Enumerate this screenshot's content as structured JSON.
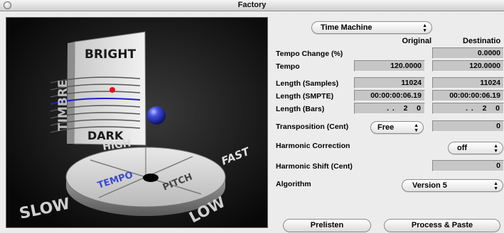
{
  "window": {
    "title": "Factory"
  },
  "visual": {
    "labels": {
      "bright": "BRIGHT",
      "timbre": "TIMBRE",
      "dark": "DARK",
      "high": "HIGH",
      "fast": "FAST",
      "slow": "SLOW",
      "low": "LOW",
      "tempo": "TEMPO",
      "pitch": "PITCH"
    }
  },
  "controls": {
    "mode_popup": "Time Machine",
    "columns": {
      "original": "Original",
      "destination": "Destinatio"
    },
    "rows": [
      {
        "label": "Tempo Change (%)",
        "original": "",
        "destination": "0.0000"
      },
      {
        "label": "Tempo",
        "original": "120.0000",
        "destination": "120.0000"
      },
      {
        "label": "Length (Samples)",
        "original": "11024",
        "destination": "11024"
      },
      {
        "label": "Length (SMPTE)",
        "original": "00:00:00:06.19",
        "destination": "00:00:00:06.19"
      },
      {
        "label": "Length (Bars)",
        "original": ". .   2   0",
        "destination": ". .   2   0"
      }
    ],
    "transposition": {
      "label": "Transposition (Cent)",
      "popup": "Free",
      "value": "0"
    },
    "harmonic_correction": {
      "label": "Harmonic Correction",
      "popup": "off"
    },
    "harmonic_shift": {
      "label": "Harmonic Shift (Cent)",
      "value": "0"
    },
    "algorithm": {
      "label": "Algorithm",
      "popup": "Version 5"
    },
    "buttons": {
      "prelisten": "Prelisten",
      "process_paste": "Process & Paste"
    }
  },
  "colors": {
    "sphere": "#3b45d6",
    "timbre_line": "#1d1dd0",
    "red_dot": "#e0101a"
  }
}
